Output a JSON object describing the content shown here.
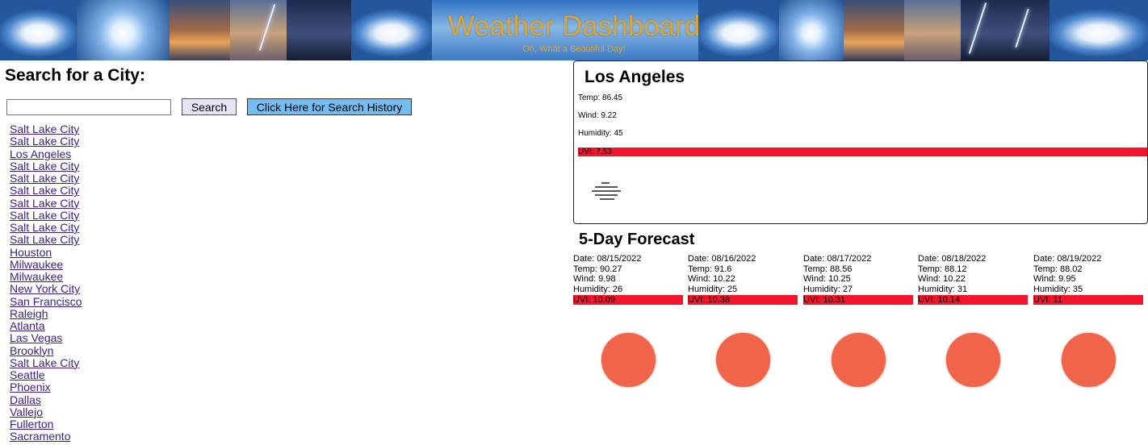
{
  "header": {
    "title": "Weather Dashboard",
    "subtitle": "Oh, What a Beautiful Day!"
  },
  "search": {
    "heading": "Search for a City:",
    "input_value": "",
    "search_button": "Search",
    "history_button": "Click Here for Search History"
  },
  "history": [
    "Salt Lake City",
    "Salt Lake City",
    "Los Angeles",
    "Salt Lake City",
    "Salt Lake City",
    "Salt Lake City",
    "Salt Lake City",
    "Salt Lake City",
    "Salt Lake City",
    "Salt Lake City",
    "Houston",
    "Milwaukee",
    "Milwaukee",
    "New York City",
    "San Francisco",
    "Raleigh",
    "Atlanta",
    "Las Vegas",
    "Brooklyn",
    "Salt Lake City",
    "Seattle",
    "Phoenix",
    "Dallas",
    "Vallejo",
    "Fullerton",
    "Sacramento"
  ],
  "current": {
    "city": "Los Angeles",
    "temp": "Temp: 86.45",
    "wind": "Wind: 9.22",
    "humidity": "Humidity: 45",
    "uvi": "UVI: 7.53",
    "uvi_color": "#f4142b",
    "icon": "fog-icon"
  },
  "forecast": {
    "heading": "5-Day Forecast",
    "days": [
      {
        "date": "Date: 08/15/2022",
        "temp": "Temp: 90.27",
        "wind": "Wind: 9.98",
        "humidity": "Humidity: 26",
        "uvi": "UVI: 10.09",
        "icon": "sun-icon"
      },
      {
        "date": "Date: 08/16/2022",
        "temp": "Temp: 91.6",
        "wind": "Wind: 10.22",
        "humidity": "Humidity: 25",
        "uvi": "UVI: 10.38",
        "icon": "sun-icon"
      },
      {
        "date": "Date: 08/17/2022",
        "temp": "Temp: 88.56",
        "wind": "Wind: 10.25",
        "humidity": "Humidity: 27",
        "uvi": "UVI: 10.31",
        "icon": "sun-icon"
      },
      {
        "date": "Date: 08/18/2022",
        "temp": "Temp: 88.12",
        "wind": "Wind: 10.22",
        "humidity": "Humidity: 31",
        "uvi": "UVI: 10.14",
        "icon": "sun-icon"
      },
      {
        "date": "Date: 08/19/2022",
        "temp": "Temp: 88.02",
        "wind": "Wind: 9.95",
        "humidity": "Humidity: 35",
        "uvi": "UVI: 11",
        "icon": "sun-icon"
      }
    ]
  },
  "colors": {
    "title_gold": "#d9a53a",
    "uvi_high": "#f4142b",
    "history_button": "#74bdf2",
    "sun": "#f0644a"
  }
}
